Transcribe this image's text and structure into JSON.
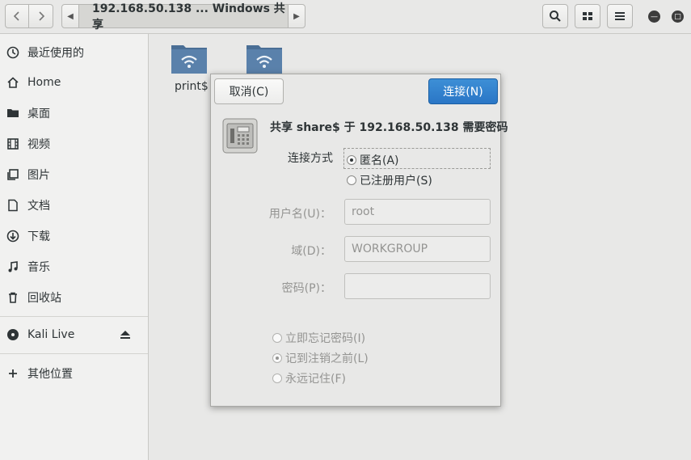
{
  "header": {
    "path": "192.168.50.138 ... Windows 共享",
    "back_icon": "chevron-left-icon",
    "forward_icon": "chevron-right-icon"
  },
  "sidebar": {
    "items": [
      {
        "label": "最近使用的",
        "icon": "recent-icon"
      },
      {
        "label": "Home",
        "icon": "home-icon"
      },
      {
        "label": "桌面",
        "icon": "desktop-folder-icon"
      },
      {
        "label": "视频",
        "icon": "video-icon"
      },
      {
        "label": "图片",
        "icon": "pictures-icon"
      },
      {
        "label": "文档",
        "icon": "document-icon"
      },
      {
        "label": "下载",
        "icon": "download-icon"
      },
      {
        "label": "音乐",
        "icon": "music-icon"
      },
      {
        "label": "回收站",
        "icon": "trash-icon"
      }
    ],
    "device": {
      "label": "Kali Live",
      "icon": "disc-icon",
      "eject_icon": "eject-icon"
    },
    "other": {
      "label": "其他位置",
      "icon": "plus-icon"
    }
  },
  "main": {
    "folders": [
      {
        "label": "print$"
      },
      {
        "label": ""
      }
    ]
  },
  "dialog": {
    "cancel_label": "取消(C)",
    "connect_label": "连接(N)",
    "title": "共享 share$ 于 192.168.50.138 需要密码",
    "connect_as_label": "连接方式",
    "anonymous_label": "匿名(A)",
    "registered_label": "已注册用户(S)",
    "username_label": "用户名(U)：",
    "username_value": "root",
    "domain_label": "域(D)：",
    "domain_value": "WORKGROUP",
    "password_label": "密码(P)：",
    "password_value": "",
    "forget_label": "立即忘记密码(I)",
    "remember_logout_label": "记到注销之前(L)",
    "remember_forever_label": "永远记住(F)",
    "accent_color": "#2a76c6"
  }
}
